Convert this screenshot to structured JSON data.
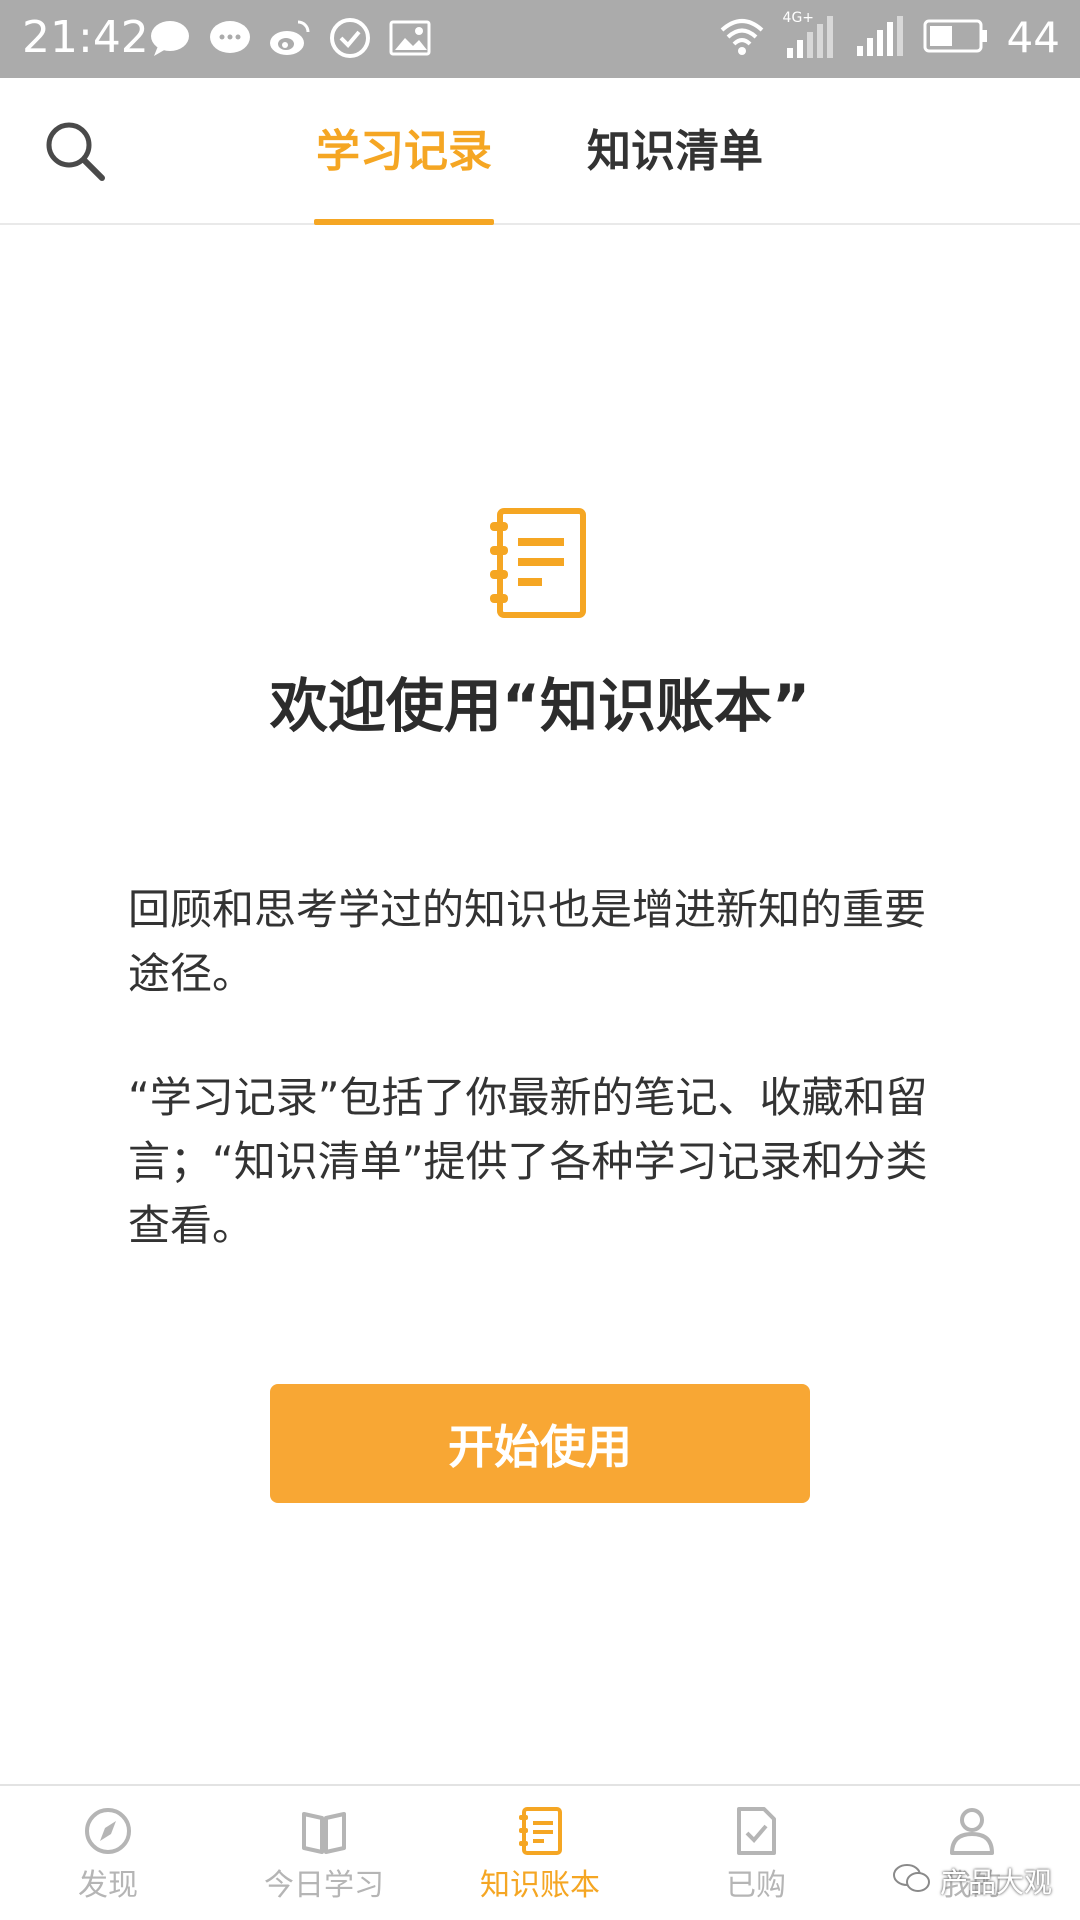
{
  "status_bar": {
    "time": "21:42",
    "network": "4G+",
    "battery": "44",
    "icons": [
      "message-icon",
      "chat-icon",
      "weibo-icon",
      "check-circle-icon",
      "image-icon",
      "wifi-icon",
      "signal-icon",
      "battery-icon"
    ]
  },
  "header": {
    "search_icon": "search-icon",
    "tabs": [
      {
        "label": "学习记录",
        "active": true
      },
      {
        "label": "知识清单",
        "active": false
      }
    ],
    "accent_color": "#f5a623"
  },
  "main": {
    "icon": "notebook-icon",
    "title": "欢迎使用“知识账本”",
    "paragraph_1": "回顾和思考学过的知识也是增进新知的重要途径。",
    "paragraph_2": "“学习记录”包括了你最新的笔记、收藏和留言；“知识清单”提供了各种学习记录和分类查看。",
    "start_button": "开始使用",
    "button_color": "#f8a734"
  },
  "bottom_nav": {
    "items": [
      {
        "label": "发现",
        "icon": "compass-icon",
        "active": false
      },
      {
        "label": "今日学习",
        "icon": "book-icon",
        "active": false
      },
      {
        "label": "知识账本",
        "icon": "notebook-icon",
        "active": true
      },
      {
        "label": "已购",
        "icon": "purchased-icon",
        "active": false
      },
      {
        "label": "我的",
        "icon": "user-icon",
        "active": false
      }
    ]
  },
  "watermark": {
    "text": "产品大观",
    "icon": "wechat-icon"
  }
}
